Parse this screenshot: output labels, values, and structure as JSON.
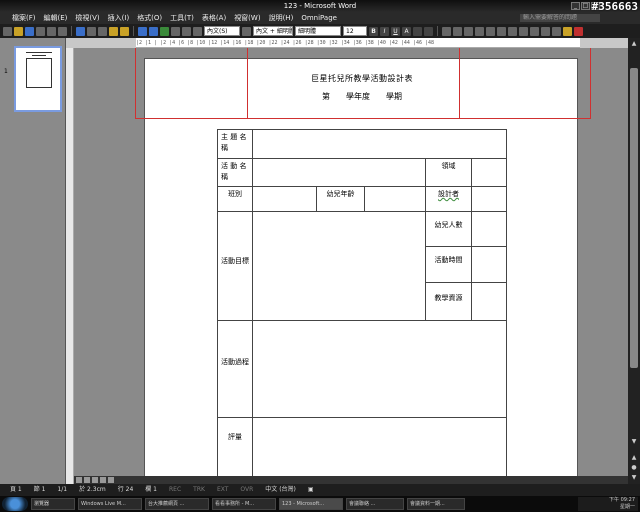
{
  "window": {
    "title": "123 - Microsoft Word",
    "watermark": "#356663",
    "controls": [
      "_",
      "□",
      "×"
    ]
  },
  "menu": {
    "items": [
      "檔案(F)",
      "編輯(E)",
      "檢視(V)",
      "插入(I)",
      "格式(O)",
      "工具(T)",
      "表格(A)",
      "視窗(W)",
      "說明(H)",
      "OmniPage"
    ],
    "help_placeholder": "輸入需要解答的問題"
  },
  "toolbar": {
    "style": "內文 + 細明體",
    "font": "細明體",
    "size": "12",
    "bold": "B",
    "italic": "I",
    "underline": "U",
    "style_left": "內文(S)",
    "font_btn": "A"
  },
  "ruler": {
    "text": "|2  |1  |  |2  |4  |6  |8  |10  |12  |14  |16  |18  |20  |22  |24  |26  |28  |30  |32  |34  |36  |38  |40  |42  |44  |46  |48"
  },
  "thumbs": {
    "page_number": "1"
  },
  "document": {
    "title": "巨星托兒所教學活動設計表",
    "subtitle": "第　　學年度　　學期",
    "table": {
      "theme_label": "主 題 名 稱",
      "activity_label": "活 動 名 稱",
      "domain_label": "領域",
      "class_label": "班別",
      "age_label": "幼兒年齡",
      "designer_label": "設計者",
      "goal_label": "活動目標",
      "count_label": "幼兒人數",
      "time_label": "活動時間",
      "resource_label": "教學資源",
      "process_label": "活動過程",
      "eval_label": "評量"
    }
  },
  "status": {
    "page": "頁 1",
    "section": "節 1",
    "ratio": "1/1",
    "position": "於 2.3cm",
    "line": "行 24",
    "column": "欄 1",
    "rec": "REC",
    "trk": "TRK",
    "ext": "EXT",
    "ovr": "OVR",
    "lang": "中文 (台灣)"
  },
  "taskbar": {
    "tasks": [
      "瀏覽器",
      "Windows Live M...",
      "台大推薦網頁 ...",
      "看看事務所 - M...",
      "123 - Microsoft...",
      "會議聯絡 ...",
      "會議資料一期..."
    ],
    "clock_time": "下午 09:27",
    "clock_day": "星期一"
  },
  "colors": {
    "selection_border": "#d03030",
    "workspace": "#8a8a8a",
    "chrome": "#1e1e1e"
  }
}
